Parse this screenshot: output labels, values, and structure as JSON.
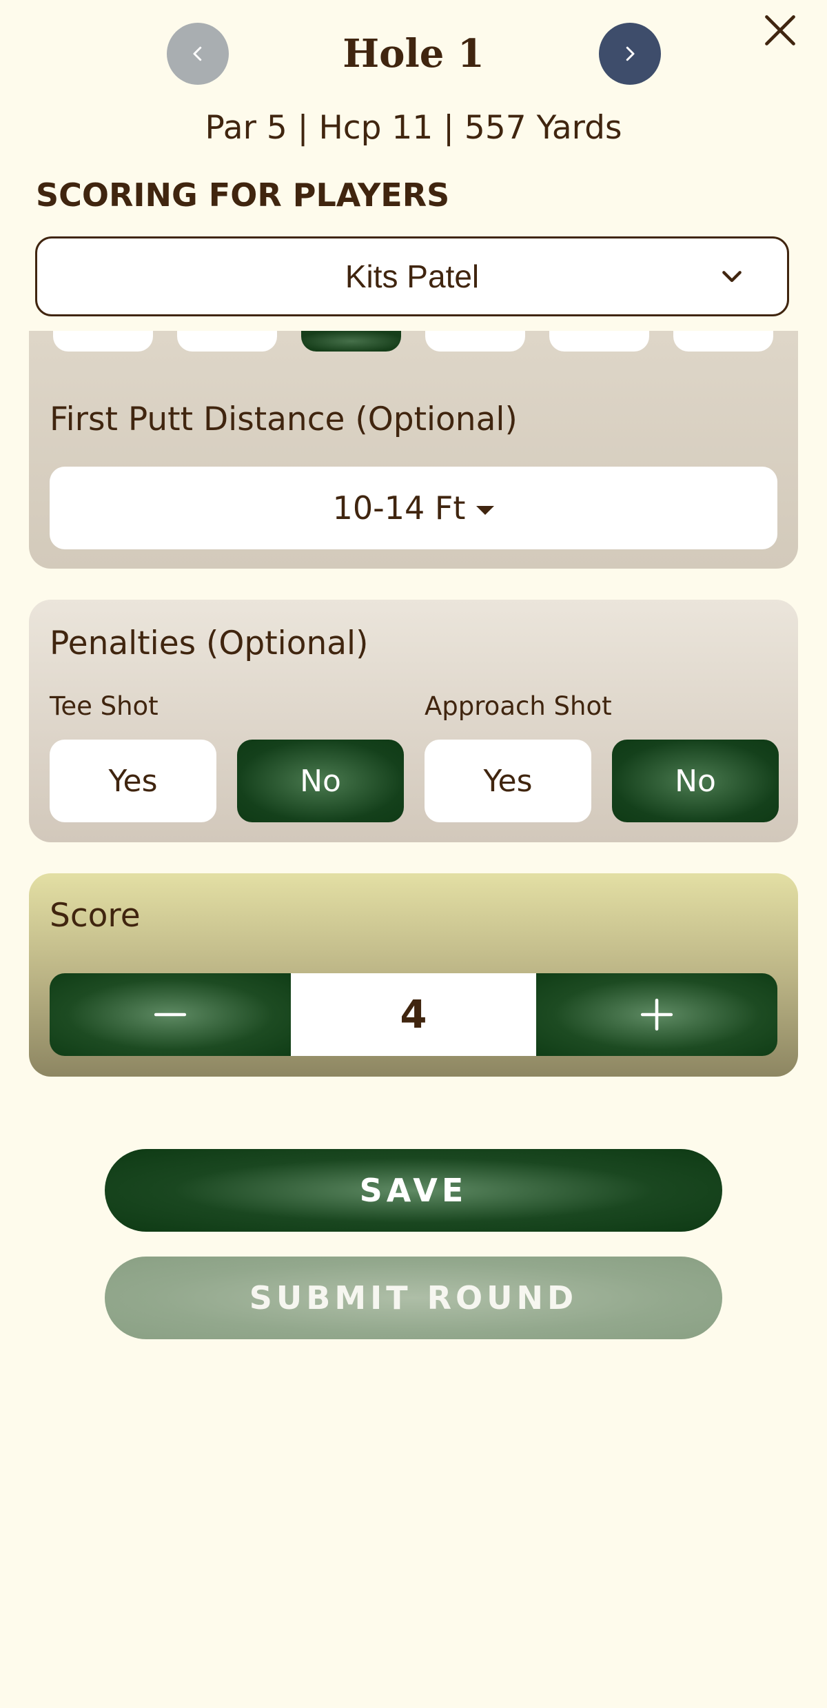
{
  "header": {
    "title": "Hole 1",
    "prev_icon": "chevron-left-icon",
    "next_icon": "chevron-right-icon",
    "close_icon": "close-icon",
    "info": "Par 5 | Hcp 11 | 557 Yards"
  },
  "scoring": {
    "label": "SCORING FOR PLAYERS",
    "selected_player": "Kits Patel",
    "dropdown_icon": "chevron-down-icon"
  },
  "putting": {
    "first_putt_label": "First Putt Distance (Optional)",
    "first_putt_value": "10-14 Ft"
  },
  "penalties": {
    "title": "Penalties (Optional)",
    "tee_shot": {
      "label": "Tee Shot",
      "yes": "Yes",
      "no": "No",
      "selected": "No"
    },
    "approach_shot": {
      "label": "Approach Shot",
      "yes": "Yes",
      "no": "No",
      "selected": "No"
    }
  },
  "score": {
    "label": "Score",
    "value": "4",
    "decrement_icon": "minus-icon",
    "increment_icon": "plus-icon"
  },
  "actions": {
    "save": "SAVE",
    "submit": "SUBMIT ROUND"
  },
  "colors": {
    "background": "#fefbec",
    "text": "#40250f",
    "primary_green": "#14401b",
    "muted_green": "#93a88d",
    "prev_button": "#a9aeb1",
    "next_button": "#3e4d6b"
  }
}
